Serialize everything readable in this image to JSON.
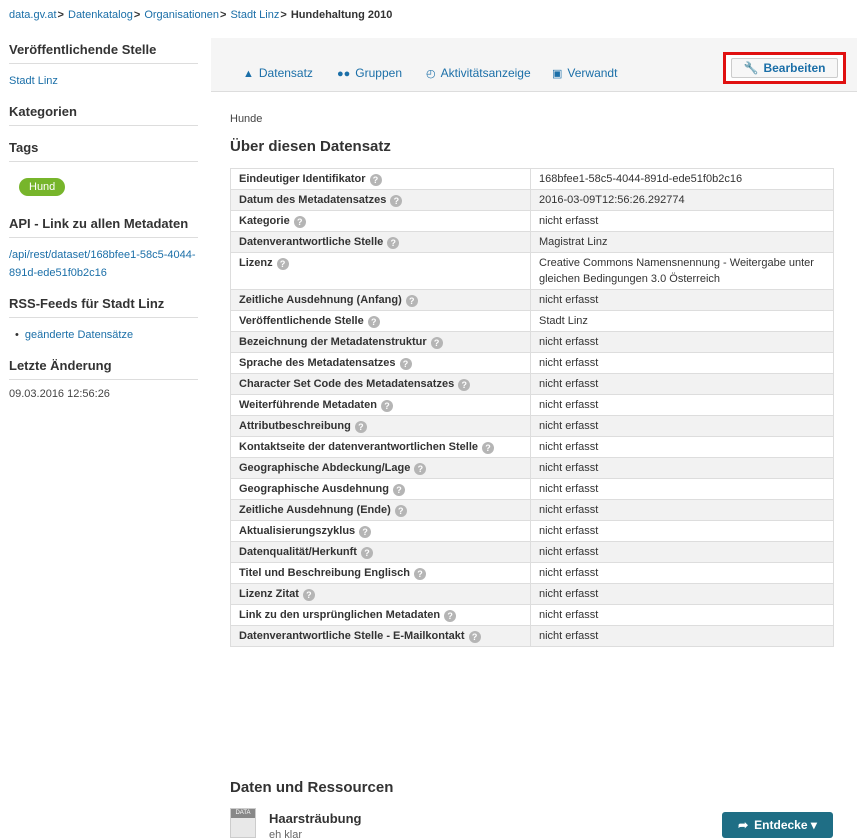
{
  "breadcrumb": {
    "items": [
      "data.gv.at",
      "Datenkatalog",
      "Organisationen",
      "Stadt Linz"
    ],
    "current": "Hundehaltung 2010",
    "separator": ">"
  },
  "sidebar": {
    "publisher_title": "Veröffentlichende Stelle",
    "publisher_link": "Stadt Linz",
    "categories_title": "Kategorien",
    "tags_title": "Tags",
    "tag": "Hund",
    "api_title": "API - Link zu allen Metadaten",
    "api_link": "/api/rest/dataset/168bfee1-58c5-4044-891d-ede51f0b2c16",
    "rss_title": "RSS-Feeds für Stadt Linz",
    "rss_item": "geänderte Datensätze",
    "last_change_title": "Letzte Änderung",
    "last_change_value": "09.03.2016 12:56:26"
  },
  "tabs": {
    "dataset": "Datensatz",
    "groups": "Gruppen",
    "activity": "Aktivitätsanzeige",
    "related": "Verwandt",
    "edit": "Bearbeiten"
  },
  "main": {
    "crumb": "Hunde",
    "about_title": "Über diesen Datensatz",
    "help_glyph": "?",
    "rows": [
      {
        "k": "Eindeutiger Identifikator",
        "v": "168bfee1-58c5-4044-891d-ede51f0b2c16"
      },
      {
        "k": "Datum des Metadatensatzes",
        "v": "2016-03-09T12:56:26.292774"
      },
      {
        "k": "Kategorie",
        "v": "nicht erfasst"
      },
      {
        "k": "Datenverantwortliche Stelle",
        "v": "Magistrat Linz"
      },
      {
        "k": "Lizenz",
        "v": "Creative Commons Namensnennung - Weitergabe unter gleichen Bedingungen 3.0 Österreich"
      },
      {
        "k": "Zeitliche Ausdehnung (Anfang)",
        "v": "nicht erfasst"
      },
      {
        "k": "Veröffentlichende Stelle",
        "v": "Stadt Linz"
      },
      {
        "k": "Bezeichnung der Metadatenstruktur",
        "v": "nicht erfasst"
      },
      {
        "k": "Sprache des Metadatensatzes",
        "v": "nicht erfasst"
      },
      {
        "k": "Character Set Code des Metadatensatzes",
        "v": "nicht erfasst"
      },
      {
        "k": "Weiterführende Metadaten",
        "v": "nicht erfasst"
      },
      {
        "k": "Attributbeschreibung",
        "v": "nicht erfasst"
      },
      {
        "k": "Kontaktseite der datenverantwortlichen Stelle",
        "v": "nicht erfasst"
      },
      {
        "k": "Geographische Abdeckung/Lage",
        "v": "nicht erfasst"
      },
      {
        "k": "Geographische Ausdehnung",
        "v": "nicht erfasst"
      },
      {
        "k": "Zeitliche Ausdehnung (Ende)",
        "v": "nicht erfasst"
      },
      {
        "k": "Aktualisierungszyklus",
        "v": "nicht erfasst"
      },
      {
        "k": "Datenqualität/Herkunft",
        "v": "nicht erfasst"
      },
      {
        "k": "Titel und Beschreibung Englisch",
        "v": "nicht erfasst"
      },
      {
        "k": "Lizenz Zitat",
        "v": "nicht erfasst"
      },
      {
        "k": "Link zu den ursprünglichen Metadaten",
        "v": "nicht erfasst"
      },
      {
        "k": "Datenverantwortliche Stelle - E-Mailkontakt",
        "v": "nicht erfasst"
      }
    ],
    "resources_title": "Daten und Ressourcen",
    "resource_icon_label": "DATA",
    "resource_name": "Haarsträubung",
    "resource_desc": "eh klar",
    "explore_label": "Entdecke"
  }
}
